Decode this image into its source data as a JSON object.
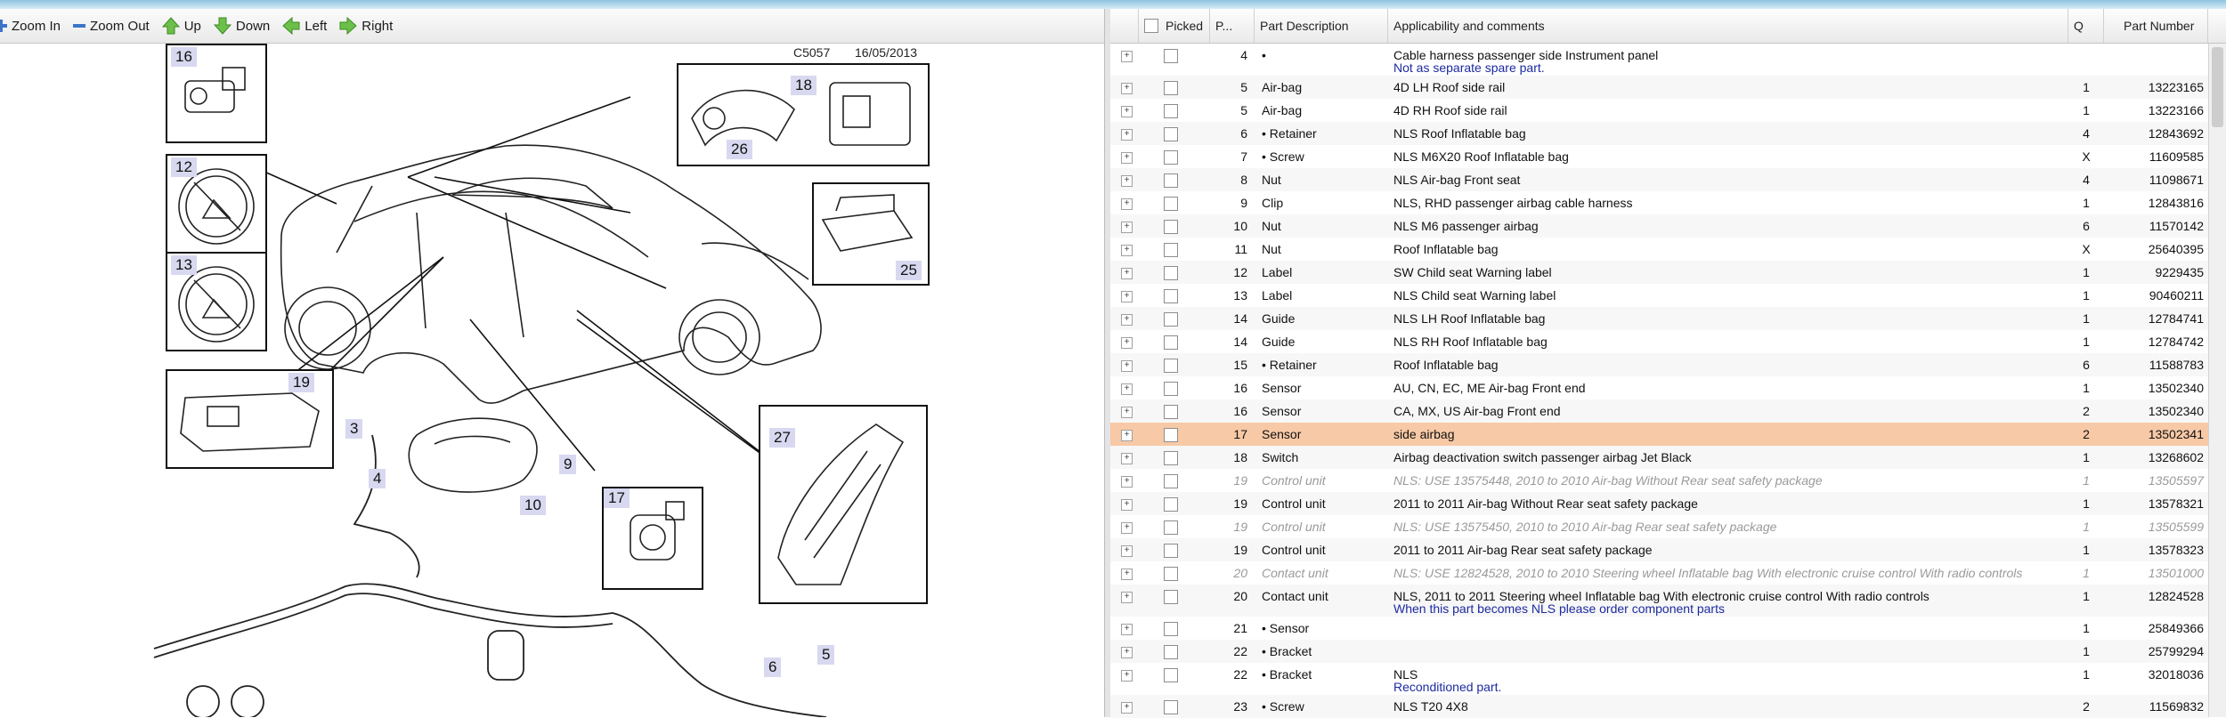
{
  "toolbar": {
    "zoom_in": "Zoom In",
    "zoom_out": "Zoom Out",
    "up": "Up",
    "down": "Down",
    "left": "Left",
    "right": "Right"
  },
  "diagram": {
    "code": "C5057",
    "date": "16/05/2013",
    "callouts": [
      "16",
      "18",
      "26",
      "12",
      "13",
      "25",
      "19",
      "3",
      "4",
      "9",
      "10",
      "17",
      "27",
      "6",
      "5"
    ]
  },
  "table": {
    "headers": {
      "picked": "Picked",
      "pos": "P...",
      "desc": "Part Description",
      "app": "Applicability and comments",
      "qty": "Q",
      "part": "Part Number"
    },
    "rows": [
      {
        "pos": "4",
        "desc": "•",
        "app": "Cable harness passenger side Instrument panel",
        "note": "Not as separate spare part.",
        "qty": "",
        "part": "",
        "state": "normal"
      },
      {
        "pos": "5",
        "desc": "Air-bag",
        "app": "4D LH Roof side rail",
        "note": "",
        "qty": "1",
        "part": "13223165",
        "state": "normal"
      },
      {
        "pos": "5",
        "desc": "Air-bag",
        "app": "4D RH Roof side rail",
        "note": "",
        "qty": "1",
        "part": "13223166",
        "state": "normal"
      },
      {
        "pos": "6",
        "desc": "• Retainer",
        "app": "NLS Roof Inflatable bag",
        "note": "",
        "qty": "4",
        "part": "12843692",
        "state": "normal"
      },
      {
        "pos": "7",
        "desc": "• Screw",
        "app": "NLS M6X20 Roof Inflatable bag",
        "note": "",
        "qty": "X",
        "part": "11609585",
        "state": "normal"
      },
      {
        "pos": "8",
        "desc": "Nut",
        "app": "NLS Air-bag Front seat",
        "note": "",
        "qty": "4",
        "part": "11098671",
        "state": "normal"
      },
      {
        "pos": "9",
        "desc": "Clip",
        "app": "NLS, RHD passenger airbag cable harness",
        "note": "",
        "qty": "1",
        "part": "12843816",
        "state": "normal"
      },
      {
        "pos": "10",
        "desc": "Nut",
        "app": "NLS M6 passenger airbag",
        "note": "",
        "qty": "6",
        "part": "11570142",
        "state": "normal"
      },
      {
        "pos": "11",
        "desc": "Nut",
        "app": "Roof Inflatable bag",
        "note": "",
        "qty": "X",
        "part": "25640395",
        "state": "normal"
      },
      {
        "pos": "12",
        "desc": "Label",
        "app": "SW Child seat Warning label",
        "note": "",
        "qty": "1",
        "part": "9229435",
        "state": "normal"
      },
      {
        "pos": "13",
        "desc": "Label",
        "app": "NLS Child seat Warning label",
        "note": "",
        "qty": "1",
        "part": "90460211",
        "state": "normal"
      },
      {
        "pos": "14",
        "desc": "Guide",
        "app": "NLS LH Roof Inflatable bag",
        "note": "",
        "qty": "1",
        "part": "12784741",
        "state": "normal"
      },
      {
        "pos": "14",
        "desc": "Guide",
        "app": "NLS RH Roof Inflatable bag",
        "note": "",
        "qty": "1",
        "part": "12784742",
        "state": "normal"
      },
      {
        "pos": "15",
        "desc": "• Retainer",
        "app": "Roof Inflatable bag",
        "note": "",
        "qty": "6",
        "part": "11588783",
        "state": "normal"
      },
      {
        "pos": "16",
        "desc": "Sensor",
        "app": "AU, CN, EC, ME Air-bag Front end",
        "note": "",
        "qty": "1",
        "part": "13502340",
        "state": "normal"
      },
      {
        "pos": "16",
        "desc": "Sensor",
        "app": "CA, MX, US Air-bag Front end",
        "note": "",
        "qty": "2",
        "part": "13502340",
        "state": "normal"
      },
      {
        "pos": "17",
        "desc": "Sensor",
        "app": "side airbag",
        "note": "",
        "qty": "2",
        "part": "13502341",
        "state": "selected"
      },
      {
        "pos": "18",
        "desc": "Switch",
        "app": "Airbag deactivation switch passenger airbag Jet Black",
        "note": "",
        "qty": "1",
        "part": "13268602",
        "state": "normal"
      },
      {
        "pos": "19",
        "desc": "Control unit",
        "app": "NLS: USE 13575448, 2010 to 2010 Air-bag Without Rear seat safety package",
        "note": "",
        "qty": "1",
        "part": "13505597",
        "state": "disabled"
      },
      {
        "pos": "19",
        "desc": "Control unit",
        "app": "2011 to 2011 Air-bag Without Rear seat safety package",
        "note": "",
        "qty": "1",
        "part": "13578321",
        "state": "normal"
      },
      {
        "pos": "19",
        "desc": "Control unit",
        "app": "NLS: USE 13575450, 2010 to 2010 Air-bag Rear seat safety package",
        "note": "",
        "qty": "1",
        "part": "13505599",
        "state": "disabled"
      },
      {
        "pos": "19",
        "desc": "Control unit",
        "app": "2011 to 2011 Air-bag Rear seat safety package",
        "note": "",
        "qty": "1",
        "part": "13578323",
        "state": "normal"
      },
      {
        "pos": "20",
        "desc": "Contact unit",
        "app": "NLS: USE 12824528, 2010 to 2010 Steering wheel Inflatable bag With electronic cruise control With radio controls",
        "note": "",
        "qty": "1",
        "part": "13501000",
        "state": "disabled"
      },
      {
        "pos": "20",
        "desc": "Contact unit",
        "app": "NLS, 2011 to 2011 Steering wheel Inflatable bag With electronic cruise control With radio controls",
        "note": "When this part becomes NLS please order component parts",
        "qty": "1",
        "part": "12824528",
        "state": "normal"
      },
      {
        "pos": "21",
        "desc": "• Sensor",
        "app": "",
        "note": "",
        "qty": "1",
        "part": "25849366",
        "state": "normal"
      },
      {
        "pos": "22",
        "desc": "• Bracket",
        "app": "",
        "note": "",
        "qty": "1",
        "part": "25799294",
        "state": "normal"
      },
      {
        "pos": "22",
        "desc": "• Bracket",
        "app": "NLS",
        "note": "Reconditioned part.",
        "qty": "1",
        "part": "32018036",
        "state": "normal"
      },
      {
        "pos": "23",
        "desc": "• Screw",
        "app": "NLS T20 4X8",
        "note": "",
        "qty": "2",
        "part": "11569832",
        "state": "normal"
      }
    ]
  }
}
